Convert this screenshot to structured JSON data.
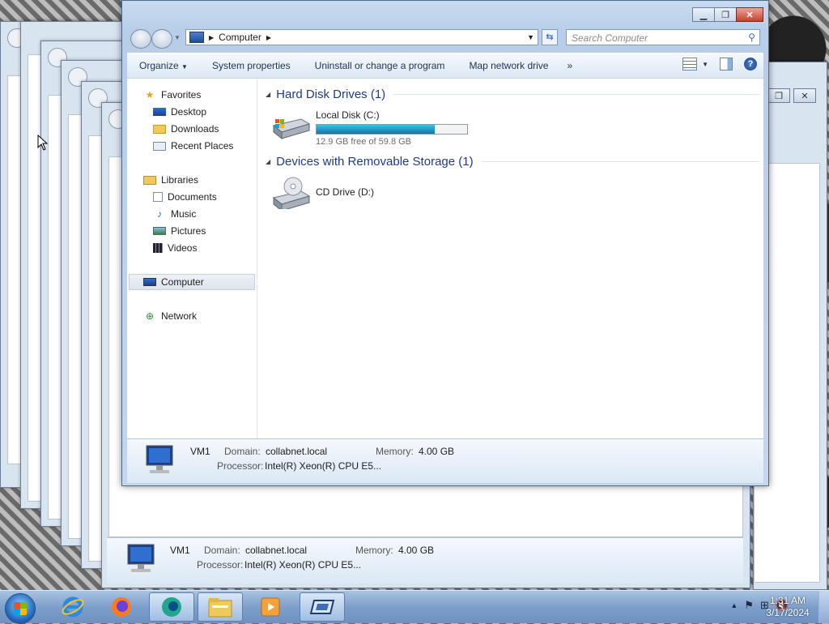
{
  "window": {
    "breadcrumb": "Computer",
    "search_placeholder": "Search Computer"
  },
  "toolbar": {
    "organize": "Organize",
    "system_properties": "System properties",
    "uninstall": "Uninstall or change a program",
    "map_drive": "Map network drive",
    "more": "»"
  },
  "nav": {
    "favorites": "Favorites",
    "desktop": "Desktop",
    "downloads": "Downloads",
    "recent": "Recent Places",
    "libraries": "Libraries",
    "documents": "Documents",
    "music": "Music",
    "pictures": "Pictures",
    "videos": "Videos",
    "computer": "Computer",
    "network": "Network"
  },
  "content": {
    "hdd_group": "Hard Disk Drives (1)",
    "removable_group": "Devices with Removable Storage (1)",
    "local_disk": {
      "label": "Local Disk (C:)",
      "free_text": "12.9 GB free of 59.8 GB",
      "used_fraction": 0.784
    },
    "cd_drive": {
      "label": "CD Drive (D:)"
    }
  },
  "details": {
    "name": "VM1",
    "domain_key": "Domain:",
    "domain_value": "collabnet.local",
    "memory_key": "Memory:",
    "memory_value": "4.00 GB",
    "processor_key": "Processor:",
    "processor_value": "Intel(R) Xeon(R) CPU E5..."
  },
  "taskbar": {
    "time": "1:31 AM",
    "date": "3/17/2024"
  }
}
